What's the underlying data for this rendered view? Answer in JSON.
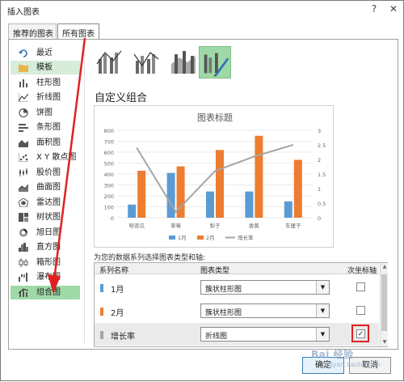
{
  "window": {
    "title": "插入图表",
    "help_label": "?",
    "close_label": "✕"
  },
  "tabs": [
    {
      "label": "推荐的图表",
      "active": false
    },
    {
      "label": "所有图表",
      "active": true
    }
  ],
  "categories": [
    {
      "label": "最近",
      "icon": "recent-icon"
    },
    {
      "label": "模板",
      "icon": "template-folder-icon"
    },
    {
      "label": "柱形图",
      "icon": "column-chart-icon"
    },
    {
      "label": "折线图",
      "icon": "line-chart-icon"
    },
    {
      "label": "饼图",
      "icon": "pie-chart-icon"
    },
    {
      "label": "条形图",
      "icon": "bar-chart-icon"
    },
    {
      "label": "面积图",
      "icon": "area-chart-icon"
    },
    {
      "label": "X Y 散点图",
      "icon": "scatter-chart-icon"
    },
    {
      "label": "股价图",
      "icon": "stock-chart-icon"
    },
    {
      "label": "曲面图",
      "icon": "surface-chart-icon"
    },
    {
      "label": "雷达图",
      "icon": "radar-chart-icon"
    },
    {
      "label": "树状图",
      "icon": "treemap-chart-icon"
    },
    {
      "label": "旭日图",
      "icon": "sunburst-chart-icon"
    },
    {
      "label": "直方图",
      "icon": "histogram-chart-icon"
    },
    {
      "label": "箱形图",
      "icon": "boxplot-chart-icon"
    },
    {
      "label": "瀑布图",
      "icon": "waterfall-chart-icon"
    },
    {
      "label": "组合图",
      "icon": "combo-chart-icon"
    }
  ],
  "selected_category": "组合图",
  "section_title": "自定义组合",
  "chart_data": {
    "type": "bar",
    "title": "图表标题",
    "categories": [
      "哈密瓜",
      "草莓",
      "梨子",
      "香蕉",
      "车厘子"
    ],
    "series": [
      {
        "name": "1月",
        "values": [
          120,
          410,
          240,
          240,
          150
        ],
        "color": "#5b9bd5",
        "kind": "bar"
      },
      {
        "name": "2月",
        "values": [
          430,
          470,
          620,
          750,
          530
        ],
        "color": "#ed7d31",
        "kind": "bar"
      },
      {
        "name": "增长率",
        "values": [
          2.4,
          0.2,
          1.6,
          2.1,
          2.5
        ],
        "color": "#a5a5a5",
        "kind": "line",
        "axis": "secondary"
      }
    ],
    "y_ticks": [
      "0",
      "100",
      "200",
      "300",
      "400",
      "500",
      "600",
      "700",
      "800"
    ],
    "y2_ticks": [
      "0",
      "0.5",
      "1",
      "1.5",
      "2",
      "2.5",
      "3"
    ],
    "ylim": [
      0,
      800
    ],
    "y2lim": [
      0,
      3
    ],
    "grid": true,
    "legend_position": "bottom"
  },
  "series_prompt": "为您的数据系列选择图表类型和轴:",
  "grid_headers": {
    "name": "系列名称",
    "type": "图表类型",
    "secondary": "次坐标轴"
  },
  "series_rows": [
    {
      "name": "1月",
      "chart_type": "簇状柱形图",
      "secondary_axis": false,
      "color": "#5b9bd5"
    },
    {
      "name": "2月",
      "chart_type": "簇状柱形图",
      "secondary_axis": false,
      "color": "#ed7d31"
    },
    {
      "name": "增长率",
      "chart_type": "折线图",
      "secondary_axis": true,
      "color": "#a5a5a5"
    }
  ],
  "buttons": {
    "ok": "确定",
    "cancel": "取消"
  },
  "watermark": {
    "brand": "Bai 经验",
    "url": "jingyan.baidu.com"
  },
  "colors": {
    "selection": "#9fd9a7",
    "highlight_border": "#e02020",
    "annotation_arrow": "#e02020"
  }
}
